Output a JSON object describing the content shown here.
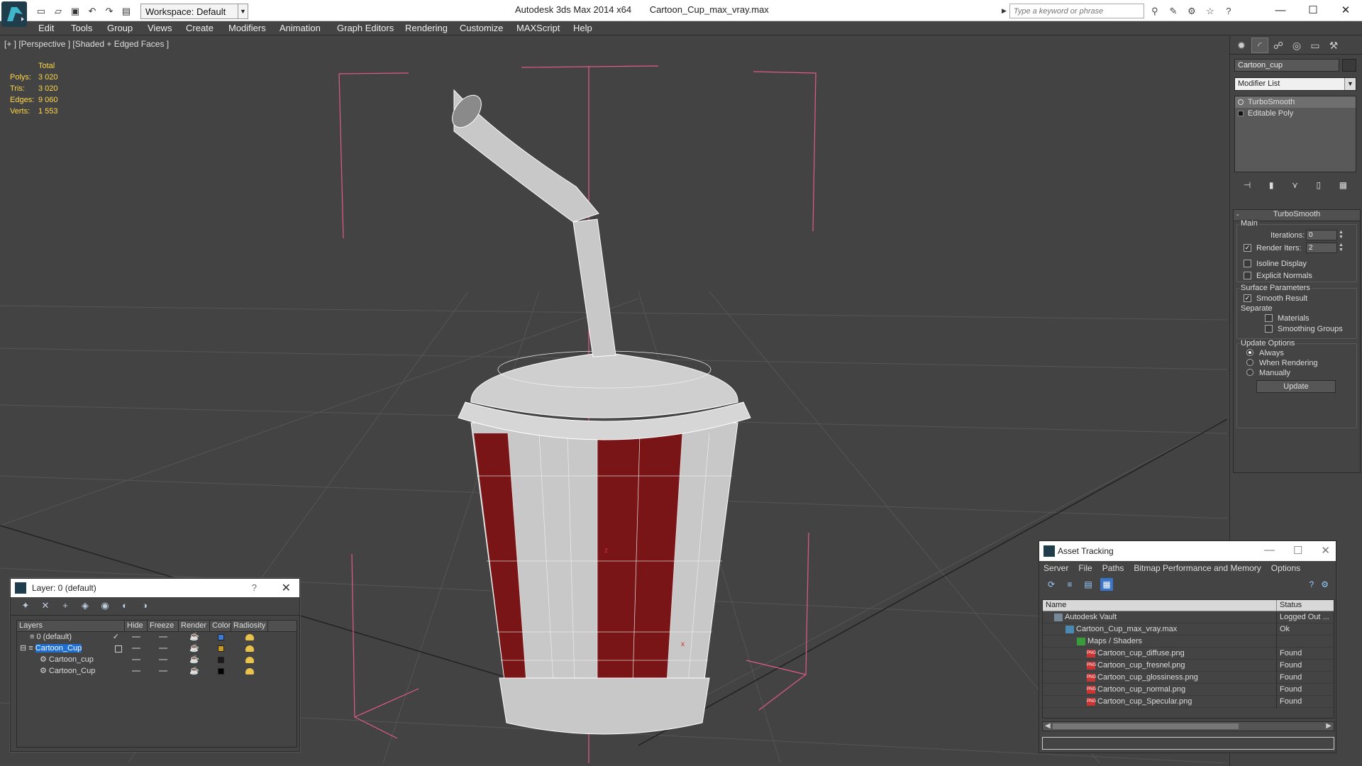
{
  "titlebar": {
    "workspace_label": "Workspace: Default",
    "app_title": "Autodesk 3ds Max  2014 x64",
    "file_name": "Cartoon_Cup_max_vray.max",
    "search_placeholder": "Type a keyword or phrase",
    "minimize": "—",
    "maximize": "☐",
    "close": "✕"
  },
  "menubar": {
    "items": [
      "Edit",
      "Tools",
      "Group",
      "Views",
      "Create",
      "Modifiers",
      "Animation",
      "Graph Editors",
      "Rendering",
      "Customize",
      "MAXScript",
      "Help"
    ]
  },
  "viewport": {
    "label": "[+ ] [Perspective ] [Shaded + Edged Faces ]",
    "stats": {
      "total_label": "Total",
      "rows": [
        {
          "key": "Polys:",
          "value": "3 020"
        },
        {
          "key": "Tris:",
          "value": "3 020"
        },
        {
          "key": "Edges:",
          "value": "9 060"
        },
        {
          "key": "Verts:",
          "value": "1 553"
        }
      ]
    },
    "axis_x": "x",
    "axis_z": "z"
  },
  "command_panel": {
    "object_name": "Cartoon_cup",
    "modifier_list": "Modifier List",
    "stack": [
      "TurboSmooth",
      "Editable Poly"
    ],
    "turbosmooth": {
      "title": "TurboSmooth",
      "main": "Main",
      "iterations_label": "Iterations:",
      "iterations_value": "0",
      "render_iters_label": "Render Iters:",
      "render_iters_value": "2",
      "render_iters_checked": true,
      "isoline_display": "Isoline Display",
      "explicit_normals": "Explicit Normals",
      "surface_parameters": "Surface Parameters",
      "smooth_result": "Smooth Result",
      "separate": "Separate",
      "materials": "Materials",
      "smoothing_groups": "Smoothing Groups",
      "update_options": "Update Options",
      "always": "Always",
      "when_rendering": "When Rendering",
      "manually": "Manually",
      "update_button": "Update"
    }
  },
  "layer_window": {
    "title": "Layer: 0 (default)",
    "help": "?",
    "close": "✕",
    "columns": [
      "Layers",
      "Hide",
      "Freeze",
      "Render",
      "Color",
      "Radiosity"
    ],
    "rows": [
      {
        "name": "0 (default)",
        "color": "#3a7bd5",
        "indent": 0
      },
      {
        "name": "Cartoon_Cup",
        "color": "#c79a1e",
        "indent": 0,
        "selected": true
      },
      {
        "name": "Cartoon_cup",
        "color": "#1a1a1a",
        "indent": 1
      },
      {
        "name": "Cartoon_Cup",
        "color": "#000000",
        "indent": 1
      }
    ]
  },
  "asset_window": {
    "title": "Asset Tracking",
    "menu": [
      "Server",
      "File",
      "Paths",
      "Bitmap Performance and Memory",
      "Options"
    ],
    "columns": [
      "Name",
      "Status"
    ],
    "rows": [
      {
        "name": "Autodesk Vault",
        "status": "Logged Out ...",
        "indent": 1,
        "icon": "vault"
      },
      {
        "name": "Cartoon_Cup_max_vray.max",
        "status": "Ok",
        "indent": 2,
        "icon": "max"
      },
      {
        "name": "Maps / Shaders",
        "status": "",
        "indent": 3,
        "icon": "fold"
      },
      {
        "name": "Cartoon_cup_diffuse.png",
        "status": "Found",
        "indent": 4,
        "icon": "png"
      },
      {
        "name": "Cartoon_cup_fresnel.png",
        "status": "Found",
        "indent": 4,
        "icon": "png"
      },
      {
        "name": "Cartoon_cup_glossiness.png",
        "status": "Found",
        "indent": 4,
        "icon": "png"
      },
      {
        "name": "Cartoon_cup_normal.png",
        "status": "Found",
        "indent": 4,
        "icon": "png"
      },
      {
        "name": "Cartoon_cup_Specular.png",
        "status": "Found",
        "indent": 4,
        "icon": "png"
      }
    ]
  },
  "colors": {
    "cup_red": "#7a1517",
    "cup_white": "#c8c8c8",
    "selection_bracket": "#e05a8a",
    "stats_yellow": "#ffd64a",
    "selected_layer": "#1f6fd3"
  }
}
